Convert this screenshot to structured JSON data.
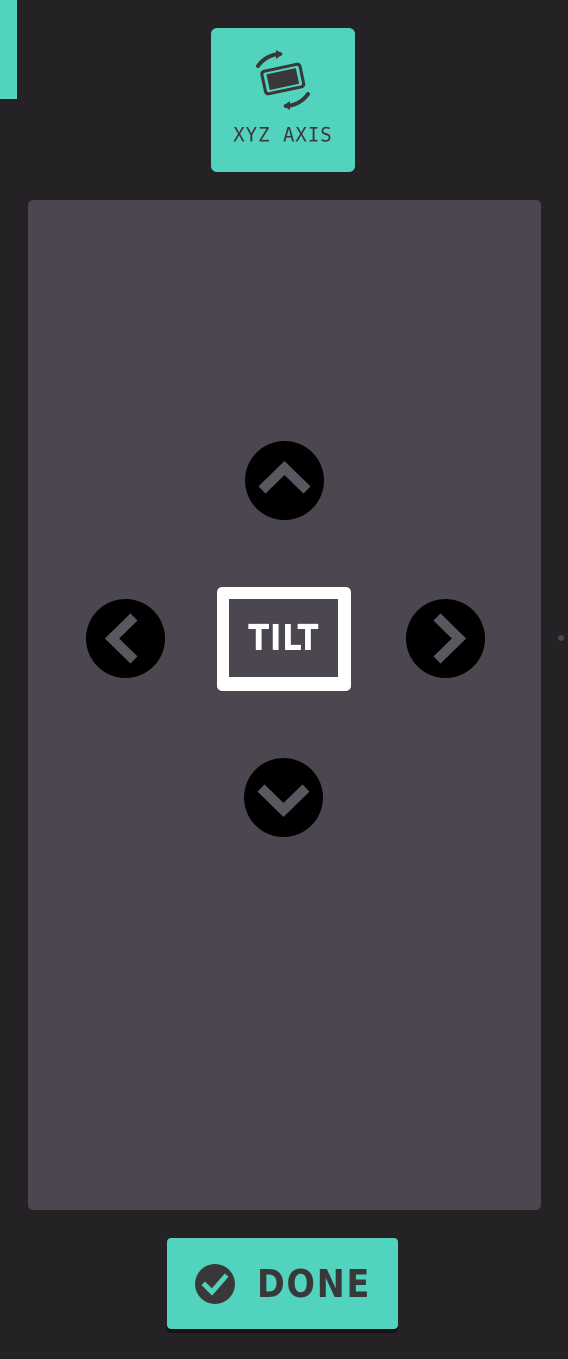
{
  "colors": {
    "background": "#252226",
    "accent": "#52d3bd",
    "panel": "#4b4650",
    "button_text": "#393839",
    "arrow_button": "#000000",
    "arrow_glyph": "#5b5760",
    "device": "#ffffff"
  },
  "mode_button": {
    "label": "XYZ AXIS",
    "icon": "rotate-device-icon"
  },
  "control_pad": {
    "center_label": "TILT",
    "up_icon": "chevron-up-icon",
    "down_icon": "chevron-down-icon",
    "left_icon": "chevron-left-icon",
    "right_icon": "chevron-right-icon"
  },
  "done_button": {
    "label": "DONE",
    "icon": "check-circle-icon"
  }
}
